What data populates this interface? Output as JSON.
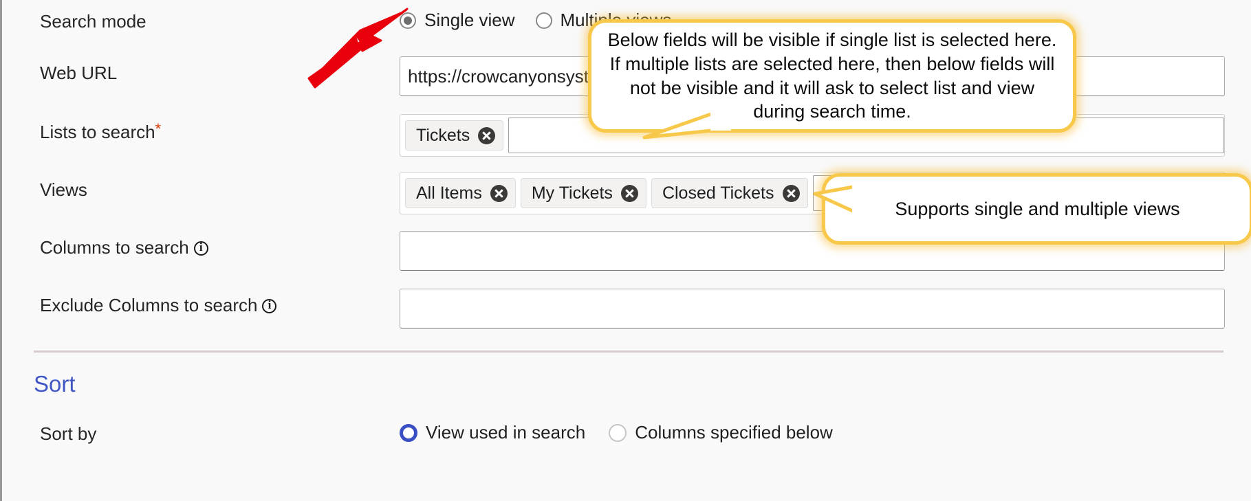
{
  "form": {
    "rows": [
      {
        "label": "Search mode",
        "type": "radio",
        "options": [
          {
            "label": "Single view",
            "checked": true
          },
          {
            "label": "Multiple views",
            "checked": false
          }
        ]
      },
      {
        "label": "Web URL",
        "type": "text",
        "value": "https://crowcanyonsystemsinc.sh"
      },
      {
        "label": "Lists to search",
        "required": "*",
        "type": "picker",
        "tags": [
          "Tickets"
        ]
      },
      {
        "label": "Views",
        "type": "picker",
        "tags": [
          "All Items",
          "My Tickets",
          "Closed Tickets"
        ],
        "caret": "chevron-down"
      },
      {
        "label": "Columns to search",
        "info": true,
        "type": "text",
        "value": ""
      },
      {
        "label": "Exclude Columns to search",
        "info": true,
        "type": "text",
        "value": ""
      }
    ]
  },
  "sort": {
    "title": "Sort",
    "sort_by_label": "Sort by",
    "options": [
      {
        "label": "View used in search",
        "checked": true
      },
      {
        "label": "Columns specified below",
        "checked": false
      }
    ]
  },
  "callouts": [
    {
      "text": "Below fields will be visible if single list is selected here. If multiple lists are selected here, then below fields will not be visible and it will ask to select list and view during search time."
    },
    {
      "text": "Supports single and multiple views"
    }
  ],
  "annotation": {
    "arrow_color": "#e8000d"
  }
}
